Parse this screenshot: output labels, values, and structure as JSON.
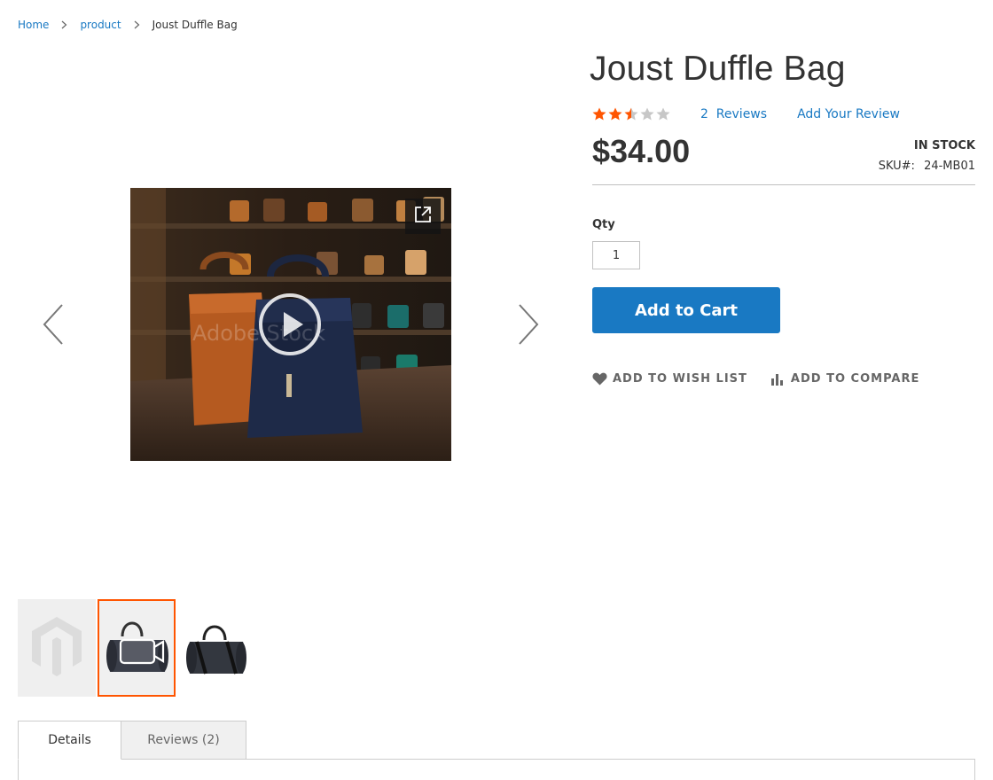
{
  "breadcrumb": {
    "items": [
      {
        "label": "Home"
      },
      {
        "label": "product"
      }
    ],
    "current": "Joust Duffle Bag"
  },
  "product": {
    "title": "Joust Duffle Bag",
    "rating_percent": 50,
    "reviews_link": "2  Reviews",
    "add_review_link": "Add Your Review",
    "price": "$34.00",
    "stock_status": "In stock",
    "sku_label": "SKU#:",
    "sku_value": "24-MB01",
    "qty_label": "Qty",
    "qty_value": "1",
    "add_to_cart_label": "Add to Cart",
    "wishlist_label": "ADD TO WISH LIST",
    "compare_label": "ADD TO COMPARE"
  },
  "gallery": {
    "watermark": "Adobe Stock",
    "thumbnail_count": 3,
    "active_thumbnail_index": 1
  },
  "tabs": [
    {
      "label": "Details",
      "active": true
    },
    {
      "label": "Reviews (2)",
      "active": false
    }
  ],
  "colors": {
    "accent_blue": "#1979c3",
    "star_orange": "#ff5501",
    "active_thumb_border": "#ff5501"
  },
  "icons": {
    "breadcrumb_separator": "chevron-right-icon",
    "gallery_prev": "chevron-left-icon",
    "gallery_next": "chevron-right-icon",
    "fullscreen": "fullscreen-icon",
    "play": "play-icon",
    "wishlist": "heart-icon",
    "compare": "compare-icon"
  }
}
